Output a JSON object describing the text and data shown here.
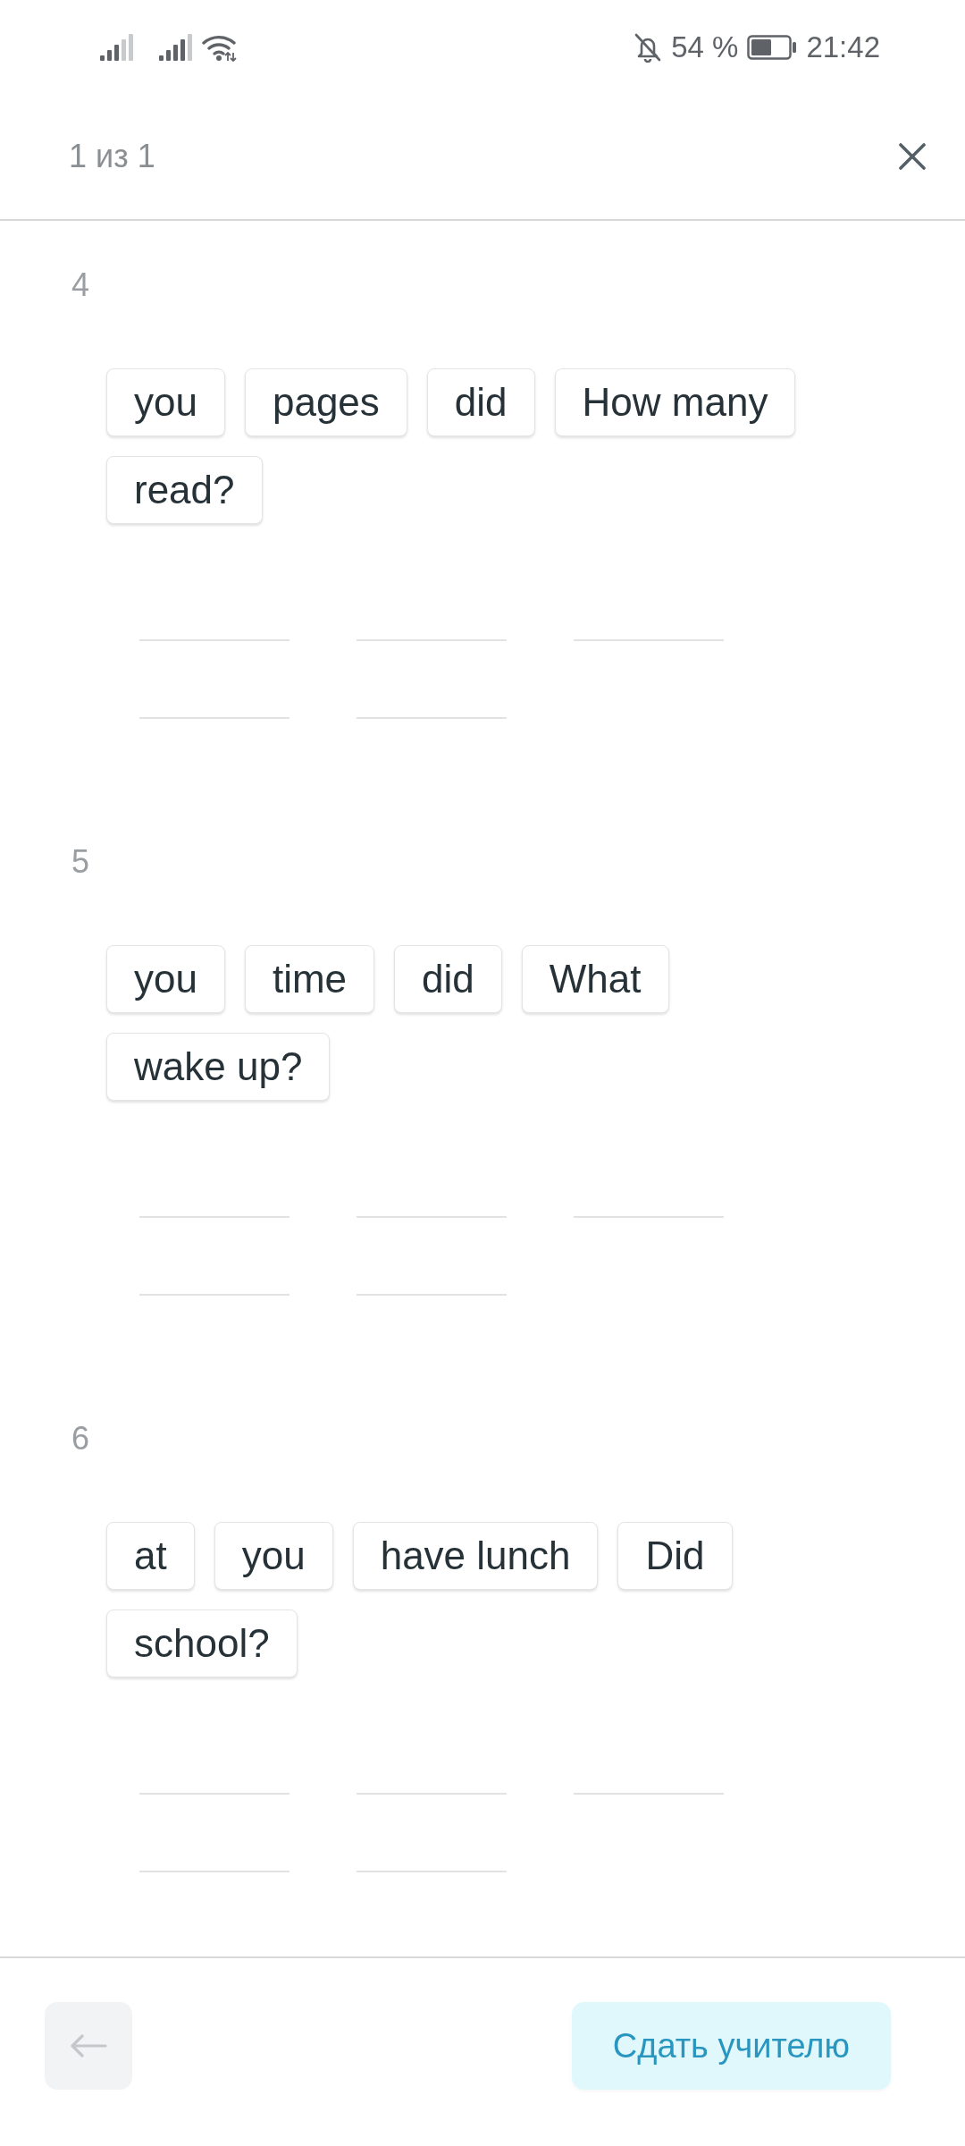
{
  "status_bar": {
    "battery": "54 %",
    "time": "21:42"
  },
  "header": {
    "counter": "1 из 1"
  },
  "questions": [
    {
      "number": "4",
      "words": [
        "you",
        "pages",
        "did",
        "How many",
        "read?"
      ]
    },
    {
      "number": "5",
      "words": [
        "you",
        "time",
        "did",
        "What",
        "wake up?"
      ]
    },
    {
      "number": "6",
      "words": [
        "at",
        "you",
        "have lunch",
        "Did",
        "school?"
      ]
    }
  ],
  "footer": {
    "back_button": {
      "disabled": true
    },
    "submit_button": "Сдать учителю"
  }
}
